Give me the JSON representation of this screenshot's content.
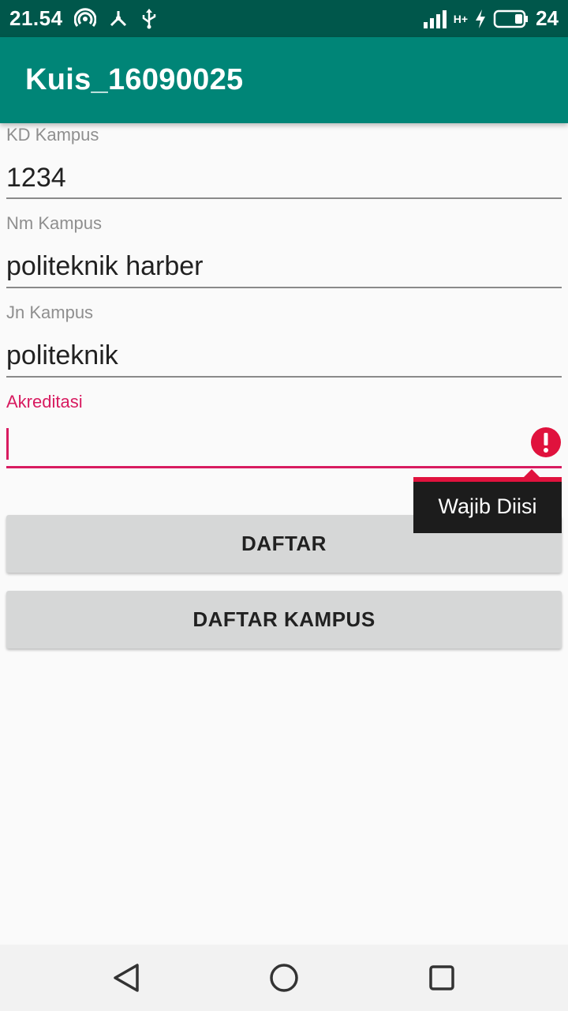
{
  "status_bar": {
    "time": "21.54",
    "network_type": "H+",
    "battery_level": "24",
    "icons": [
      "hotspot-icon",
      "share-icon",
      "usb-icon",
      "signal-icon",
      "charging-icon",
      "battery-icon"
    ]
  },
  "app_bar": {
    "title": "Kuis_16090025",
    "color": "#008577"
  },
  "form": {
    "kd_kampus": {
      "label": "KD Kampus",
      "value": "1234"
    },
    "nm_kampus": {
      "label": "Nm Kampus",
      "value": "politeknik harber"
    },
    "jn_kampus": {
      "label": "Jn Kampus",
      "value": "politeknik"
    },
    "akreditasi": {
      "label": "Akreditasi",
      "value": "",
      "error": "Wajib Diisi",
      "accent_color": "#d81b60"
    }
  },
  "buttons": {
    "daftar": "DAFTAR",
    "daftar_kampus": "DAFTAR KAMPUS"
  },
  "nav_bar": {
    "icons": [
      "back-icon",
      "home-icon",
      "recents-icon"
    ]
  }
}
